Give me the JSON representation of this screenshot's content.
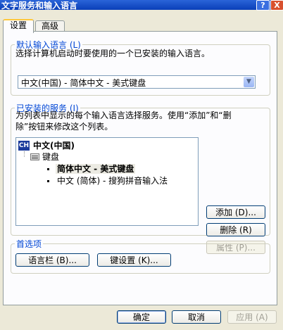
{
  "window": {
    "title": "文字服务和输入语言",
    "help_label": "?",
    "close_label": "X"
  },
  "tabs": [
    {
      "label": "设置"
    },
    {
      "label": "高级"
    }
  ],
  "default_language": {
    "legend": "默认输入语言 (L)",
    "description": "选择计算机启动时要使用的一个已安装的输入语言。",
    "selected": "中文(中国) - 简体中文 - 美式键盘"
  },
  "installed_services": {
    "legend": "已安装的服务 (I)",
    "description_line1": "为列表中显示的每个输入语言选择服务。使用“添加”和“删",
    "description_line2": "除”按钮来修改这个列表。",
    "language_badge": "CH",
    "language": "中文(中国)",
    "category": "键盘",
    "services": [
      "简体中文 - 美式键盘",
      "中文 (简体) - 搜狗拼音输入法"
    ],
    "add_label": "添加 (D)...",
    "remove_label": "删除 (R)",
    "properties_label": "属性 (P)..."
  },
  "preferences": {
    "legend": "首选项",
    "language_bar_label": "语言栏 (B)...",
    "key_settings_label": "键设置 (K)..."
  },
  "footer": {
    "ok_label": "确定",
    "cancel_label": "取消",
    "apply_label": "应用 (A)"
  }
}
